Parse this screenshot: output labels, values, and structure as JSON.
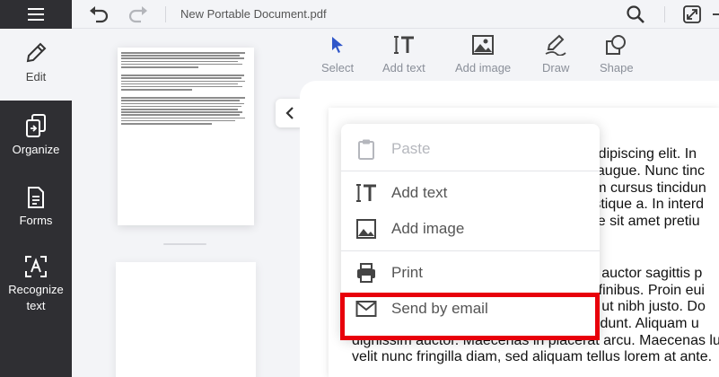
{
  "header": {
    "doc_title": "New Portable Document.pdf"
  },
  "sidebar": {
    "items": [
      {
        "label": "Edit",
        "icon": "pencil-icon"
      },
      {
        "label": "Organize",
        "icon": "pages-icon"
      },
      {
        "label": "Forms",
        "icon": "form-icon"
      },
      {
        "label": "Recognize",
        "label2": "text",
        "icon": "ocr-icon"
      }
    ]
  },
  "toolbar": {
    "tools": [
      {
        "label": "Select",
        "icon": "cursor-icon"
      },
      {
        "label": "Add text",
        "icon": "text-icon"
      },
      {
        "label": "Add image",
        "icon": "image-icon"
      },
      {
        "label": "Draw",
        "icon": "pen-icon"
      },
      {
        "label": "Shape",
        "icon": "shape-icon"
      }
    ]
  },
  "document": {
    "lines": [
      "r adipiscing elit. In",
      "la augue. Nunc tinc",
      "rem cursus tincidun",
      "tristique a. In interd",
      "que sit amet pretiu",
      "rbi auctor sagittis p",
      "er finibus. Proin eui",
      "ue ut nibh justo. Do",
      "ncidunt. Aliquam u",
      "dignissim auctor. Maecenas in placerat arcu. Maecenas lu",
      "velit nunc fringilla diam, sed aliquam tellus lorem at ante."
    ]
  },
  "context_menu": {
    "items": [
      {
        "label": "Paste",
        "icon": "clipboard-icon",
        "enabled": false
      },
      {
        "label": "Add text",
        "icon": "text-icon",
        "enabled": true
      },
      {
        "label": "Add image",
        "icon": "image-icon",
        "enabled": true
      },
      {
        "label": "Print",
        "icon": "printer-icon",
        "enabled": true
      },
      {
        "label": "Send by email",
        "icon": "mail-icon",
        "enabled": true
      }
    ]
  },
  "colors": {
    "sidebar_dark": "#2f2f33",
    "select_accent": "#2f56c9",
    "highlight": "#e8000b"
  }
}
